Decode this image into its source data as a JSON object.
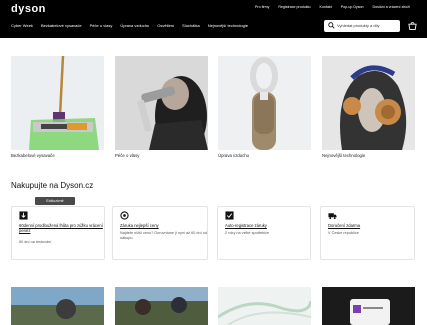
{
  "header": {
    "logo": "dyson",
    "top_links": [
      "Pro firmy",
      "Registrace produktu",
      "Kontakt",
      "Pop-up Dyson",
      "Doslání a vrácení zboží"
    ],
    "nav": [
      "Cyber Week",
      "Bezkabelové vysavače",
      "Péče o vlasy",
      "Úprava vzduchu",
      "Osvětlení",
      "Sluchátka",
      "Nejnovější technologie"
    ],
    "search_placeholder": "Vyhledat produkty a díly"
  },
  "tiles": [
    {
      "label": "Bezkabelové vysavače"
    },
    {
      "label": "Péče o vlasy"
    },
    {
      "label": "Úprava vzduchu"
    },
    {
      "label": "Nejnovější technologie"
    }
  ],
  "section": {
    "title": "Nakupujte na Dyson.cz",
    "badge": "Exkluzivně",
    "cards": [
      {
        "title": "60denní prodloužená lhůta pro zúžku vrácení peněz",
        "desc": "60 dní na testování",
        "icon": "box-icon"
      },
      {
        "title": "Záruka nejlepší ceny",
        "desc": "Najdete nižší cenu? Dorovnáme ji nyní až 60 dní od nákupu.",
        "icon": "price-guarantee-icon"
      },
      {
        "title": "Auto-registrace záruky",
        "desc": "2 roky na velké spotřebiče",
        "icon": "certificate-icon"
      },
      {
        "title": "Doručení zdarma",
        "desc": "V České republice",
        "icon": "truck-icon"
      }
    ]
  },
  "colors": {
    "header_bg": "#000000",
    "tile_bg": "#eceff1"
  }
}
